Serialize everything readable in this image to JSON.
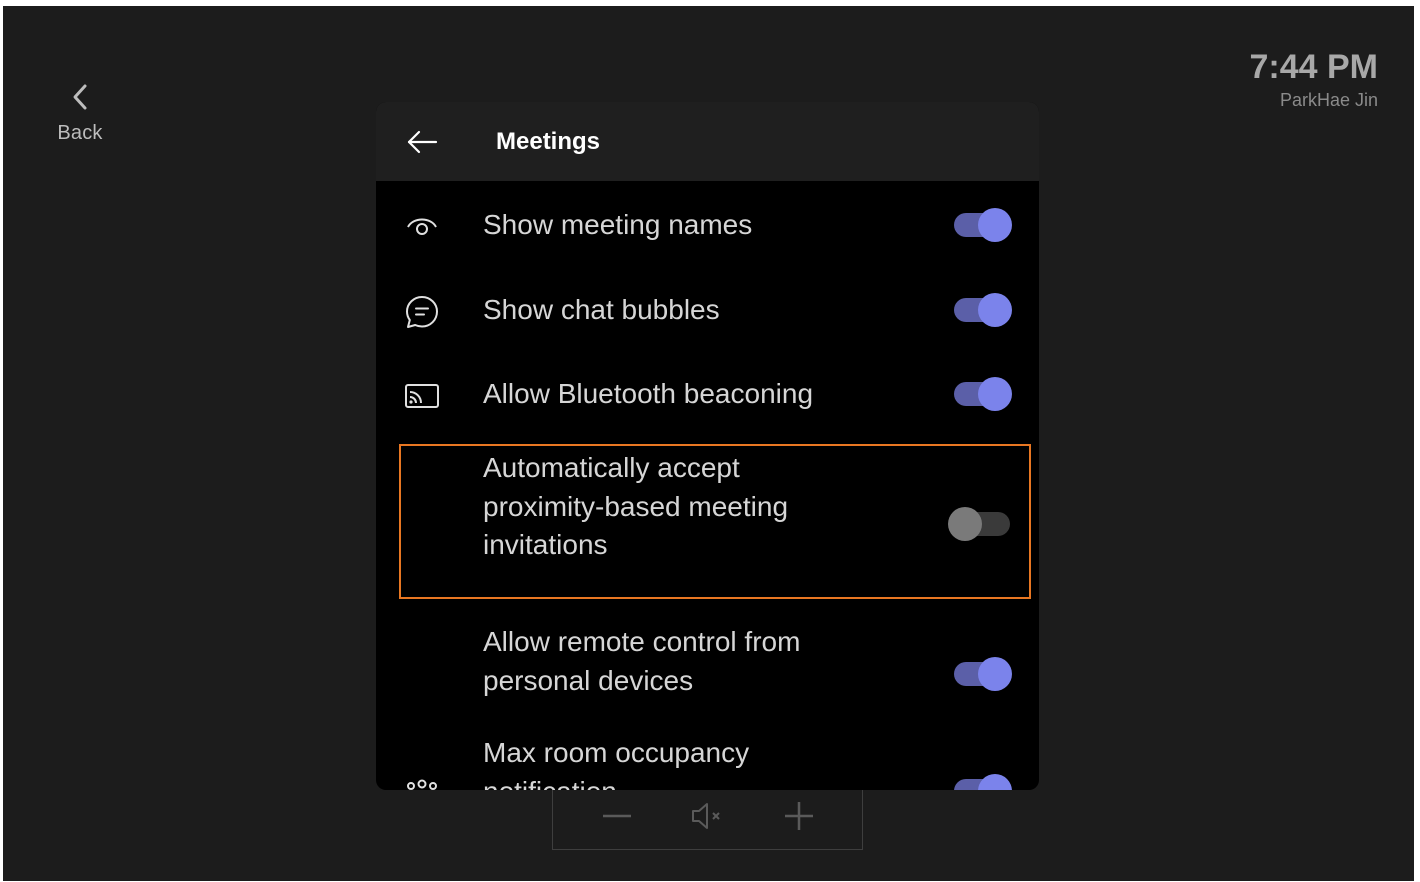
{
  "nav": {
    "back_label": "Back"
  },
  "status": {
    "time": "7:44 PM",
    "user": "ParkHae Jin"
  },
  "panel": {
    "title": "Meetings",
    "rows": [
      {
        "icon": "eye-icon",
        "label_lines": [
          "Show meeting names"
        ],
        "toggle": "on"
      },
      {
        "icon": "chat-bubble-icon",
        "label_lines": [
          "Show chat bubbles"
        ],
        "toggle": "on"
      },
      {
        "icon": "cast-icon",
        "label_lines": [
          "Allow Bluetooth beaconing"
        ],
        "toggle": "on"
      },
      {
        "icon": "",
        "label_lines": [
          "Automatically accept",
          "proximity-based meeting",
          "invitations"
        ],
        "toggle": "off"
      },
      {
        "icon": "",
        "label_lines": [
          "Allow remote control from",
          "personal devices"
        ],
        "toggle": "on"
      },
      {
        "icon": "people-icon",
        "label_lines": [
          "Max room occupancy",
          "notification"
        ],
        "toggle": "on"
      }
    ]
  },
  "volume": {
    "decrease_icon": "minus-icon",
    "mute_icon": "speaker-muted-icon",
    "increase_icon": "plus-icon"
  },
  "colors": {
    "accent": "#7b83eb",
    "accent_track": "#5b5fa8",
    "highlight": "#e87722",
    "background": "#1c1c1c",
    "panel": "#000000"
  }
}
